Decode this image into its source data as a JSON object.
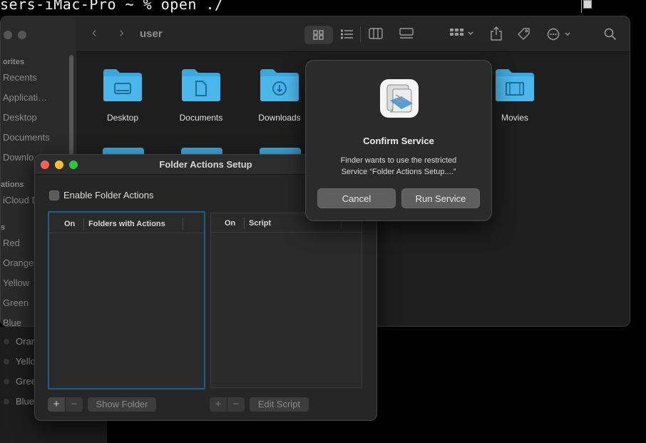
{
  "terminal": {
    "prompt_text": "sers-iMac-Pro ~ % open ./"
  },
  "finder": {
    "path_title": "user",
    "sidebar": {
      "favorites_heading": "orites",
      "favorites": [
        "Recents",
        "Applicati…",
        "Desktop",
        "Documents",
        "Downlo…"
      ],
      "locations_heading": "ations",
      "locations": [
        "iCloud D"
      ],
      "tags_heading": "s",
      "tags": [
        "Red",
        "Orange",
        "Yellow",
        "Green",
        "Blue"
      ],
      "tags_extra": [
        "Oran",
        "Yello",
        "Gree",
        "Blue"
      ]
    },
    "folders": [
      {
        "label": "Desktop",
        "icon": "desktop-folder-icon"
      },
      {
        "label": "Documents",
        "icon": "documents-folder-icon"
      },
      {
        "label": "Downloads",
        "icon": "downloads-folder-icon"
      },
      {
        "label": "Movies",
        "icon": "movies-folder-icon"
      }
    ]
  },
  "folder_actions": {
    "title": "Folder Actions Setup",
    "enable_label": "Enable Folder Actions",
    "left_table": {
      "col_on": "On",
      "col_folders": "Folders with Actions"
    },
    "right_table": {
      "col_on": "On",
      "col_script": "Script"
    },
    "add_label": "+",
    "remove_label": "−",
    "show_folder_label": "Show Folder",
    "edit_script_label": "Edit Script"
  },
  "confirm": {
    "title": "Confirm Service",
    "message_line1": "Finder wants to use the restricted",
    "message_line2": "Service “Folder Actions Setup....”",
    "cancel_label": "Cancel",
    "run_label": "Run Service"
  },
  "colors": {
    "folder_blue": "#4bb6ea",
    "focus_ring": "#1e5f8c",
    "tl_close": "#fe5f57",
    "tl_min": "#febc2e",
    "tl_max": "#28c840"
  }
}
